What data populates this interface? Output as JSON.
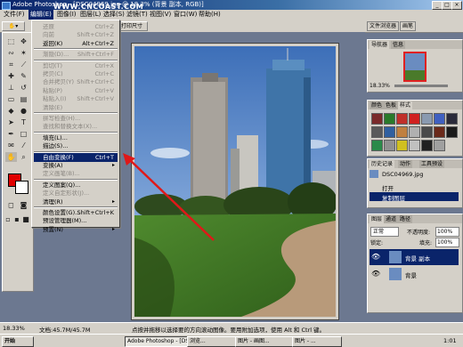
{
  "window": {
    "title": "Adobe Photoshop - [DSC04969.jpg @ 18.3% (背景 副本, RGB)]",
    "watermark": "WWW.CNCOAST.COM"
  },
  "menubar": {
    "items": [
      {
        "label": "文件(F)"
      },
      {
        "label": "编辑(E)"
      },
      {
        "label": "图像(I)"
      },
      {
        "label": "图层(L)"
      },
      {
        "label": "选择(S)"
      },
      {
        "label": "滤镜(T)"
      },
      {
        "label": "视图(V)"
      },
      {
        "label": "窗口(W)"
      },
      {
        "label": "帮助(H)"
      }
    ]
  },
  "options_bar": {
    "print_size_button": "打印尺寸",
    "file_browser_tab": "文件浏览器",
    "brushes_tab": "画笔"
  },
  "edit_menu": {
    "items": [
      {
        "label": "还原",
        "shortcut": "Ctrl+Z",
        "disabled": true
      },
      {
        "label": "向前",
        "shortcut": "Shift+Ctrl+Z",
        "disabled": true
      },
      {
        "label": "返回(K)",
        "shortcut": "Alt+Ctrl+Z",
        "disabled": false
      },
      {
        "label": "渐隐(D)...",
        "shortcut": "Shift+Ctrl+F",
        "disabled": true
      },
      {
        "label": "剪切(T)",
        "shortcut": "Ctrl+X",
        "disabled": true
      },
      {
        "label": "拷贝(C)",
        "shortcut": "Ctrl+C",
        "disabled": true
      },
      {
        "label": "合并拷贝(Y)",
        "shortcut": "Shift+Ctrl+C",
        "disabled": true
      },
      {
        "label": "粘贴(P)",
        "shortcut": "Ctrl+V",
        "disabled": true
      },
      {
        "label": "粘贴入(I)",
        "shortcut": "Shift+Ctrl+V",
        "disabled": true
      },
      {
        "label": "清除(E)",
        "shortcut": "",
        "disabled": true
      },
      {
        "label": "拼写检查(H)...",
        "shortcut": "",
        "disabled": true
      },
      {
        "label": "查找和替换文本(X)...",
        "shortcut": "",
        "disabled": true
      },
      {
        "label": "填充(L)...",
        "shortcut": "",
        "disabled": false
      },
      {
        "label": "描边(S)...",
        "shortcut": "",
        "disabled": false
      },
      {
        "label": "自由变换(F)",
        "shortcut": "Ctrl+T",
        "disabled": false,
        "highlighted": true
      },
      {
        "label": "变换(A)",
        "shortcut": "",
        "disabled": false,
        "submenu": true
      },
      {
        "label": "定义画笔(B)...",
        "shortcut": "",
        "disabled": true
      },
      {
        "label": "定义图案(Q)...",
        "shortcut": "",
        "disabled": false
      },
      {
        "label": "定义自定形状(J)...",
        "shortcut": "",
        "disabled": true
      },
      {
        "label": "清理(R)",
        "shortcut": "",
        "disabled": false,
        "submenu": true
      },
      {
        "label": "颜色设置(G)...",
        "shortcut": "Shift+Ctrl+K",
        "disabled": false
      },
      {
        "label": "预设管理器(M)...",
        "shortcut": "",
        "disabled": false
      },
      {
        "label": "预置(N)",
        "shortcut": "",
        "disabled": false,
        "submenu": true
      }
    ]
  },
  "navigator": {
    "tabs": [
      "导航器",
      "信息"
    ],
    "zoom": "18.33%"
  },
  "styles_panel": {
    "tabs": [
      "颜色",
      "色板",
      "样式"
    ],
    "swatches": [
      "#7a2a2a",
      "#2a7a2a",
      "#c0302a",
      "#d02020",
      "#8a9ab0",
      "#4060c0",
      "#2a2a3a",
      "#5a5a5a",
      "#3060a0",
      "#c08040",
      "#b0b0b0",
      "#4a4a4a",
      "#6a2a1a",
      "#1a1a1a",
      "#2a8a4a",
      "#909090",
      "#d0c020",
      "#c0c0c0",
      "#202020",
      "#a0a0a0"
    ]
  },
  "history": {
    "tabs": [
      "历史记录",
      "动作",
      "工具预设"
    ],
    "snapshot": "DSC04969.jpg",
    "steps": [
      {
        "label": "打开",
        "active": false
      },
      {
        "label": "复制图层",
        "active": true
      }
    ]
  },
  "layers": {
    "tabs": [
      "图层",
      "通道",
      "路径"
    ],
    "blend_mode": "正常",
    "opacity_label": "不透明度:",
    "opacity": "100%",
    "lock_label": "锁定:",
    "fill_label": "填充:",
    "fill": "100%",
    "items": [
      {
        "name": "背景 副本",
        "active": true
      },
      {
        "name": "背景",
        "active": false
      }
    ]
  },
  "status": {
    "zoom": "18.33%",
    "doc": "文档:45.7M/45.7M",
    "hint": "点按并拖移以选择要的方向滚动图像。要用附加选项，使用 Alt 和 Ctrl 键。"
  },
  "taskbar": {
    "start": "开始",
    "tasks": [
      "Adobe Photoshop - [DSC...",
      "浏览...",
      "图片 - 画图...",
      "图片 - ..."
    ],
    "clock": "1:01"
  }
}
